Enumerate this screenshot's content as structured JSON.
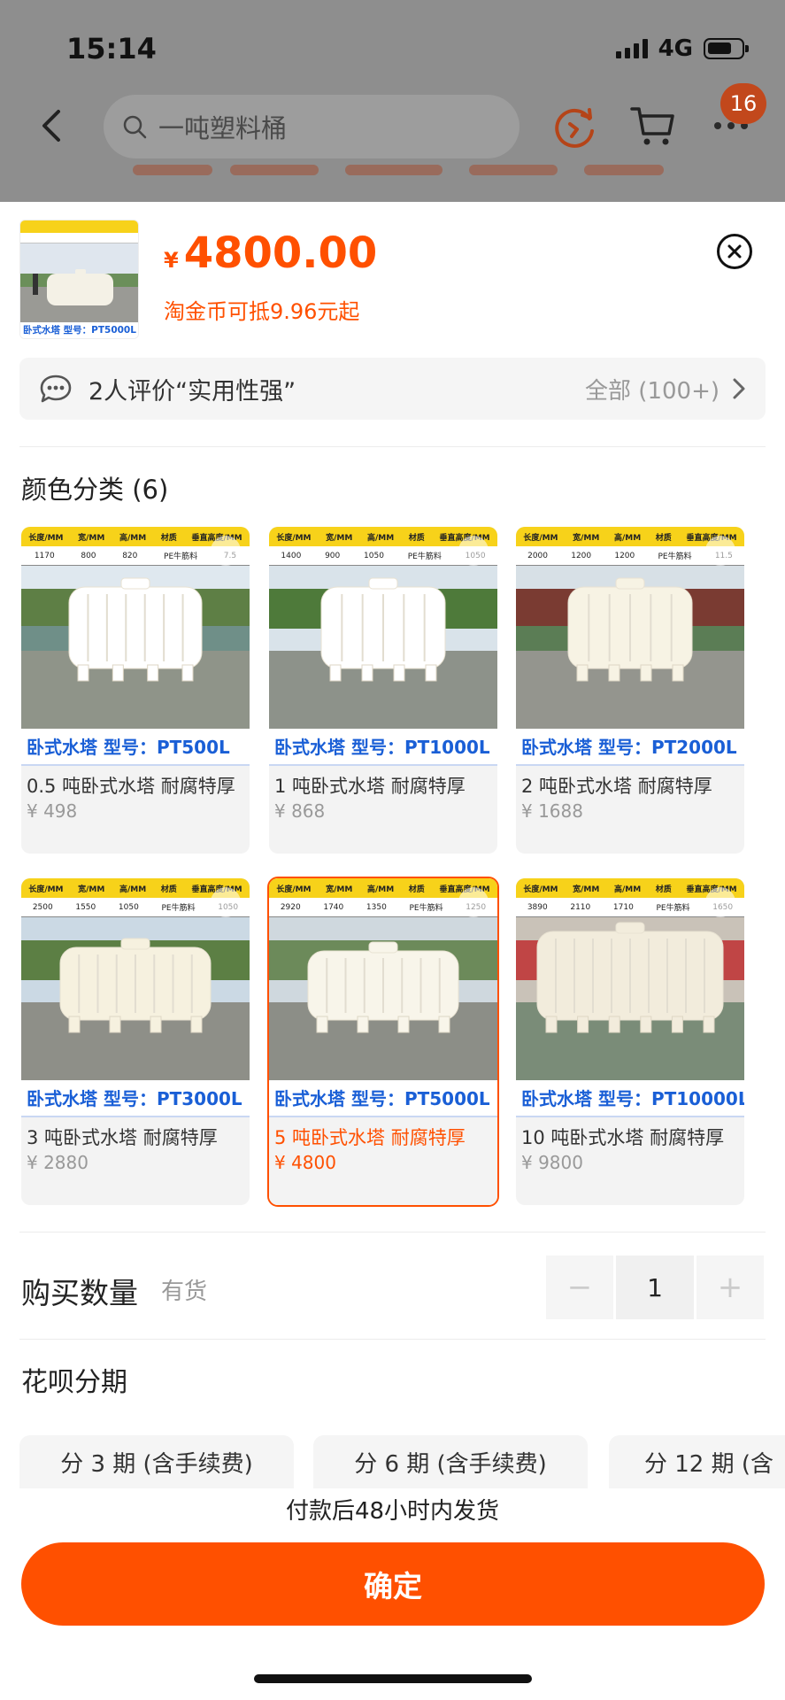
{
  "status_bar": {
    "time": "15:14",
    "network": "4G"
  },
  "background_page": {
    "search_placeholder": "一吨塑料桶",
    "cart_badge": "16"
  },
  "sheet": {
    "price_currency": "¥",
    "price": "4800.00",
    "coin_text": "淘金币可抵9.96元起",
    "thumb_label": "卧式水塔 型号：PT5000L",
    "review_text": "2人评价“实用性强”",
    "review_all": "全部 (100+)",
    "color_section_title": "颜色分类 (6)",
    "spec_headers": [
      "长度/MM",
      "宽/MM",
      "高/MM",
      "材质",
      "垂直高度/MM"
    ],
    "products": [
      {
        "model": "卧式水塔 型号：PT500L",
        "name": "0.5 吨卧式水塔 耐腐特厚",
        "price": "¥ 498",
        "specs": [
          "1170",
          "800",
          "820",
          "PE牛筋料",
          "7.5"
        ]
      },
      {
        "model": "卧式水塔 型号：PT1000L",
        "name": "1 吨卧式水塔 耐腐特厚",
        "price": "¥ 868",
        "specs": [
          "1400",
          "900",
          "1050",
          "PE牛筋料",
          "1050"
        ]
      },
      {
        "model": "卧式水塔 型号：PT2000L",
        "name": "2 吨卧式水塔 耐腐特厚",
        "price": "¥ 1688",
        "specs": [
          "2000",
          "1200",
          "1200",
          "PE牛筋料",
          "11.5"
        ]
      },
      {
        "model": "卧式水塔 型号：PT3000L",
        "name": "3 吨卧式水塔 耐腐特厚",
        "price": "¥ 2880",
        "specs": [
          "2500",
          "1550",
          "1050",
          "PE牛筋料",
          "1050"
        ]
      },
      {
        "model": "卧式水塔 型号：PT5000L",
        "name": "5 吨卧式水塔 耐腐特厚",
        "price": "¥ 4800",
        "specs": [
          "2920",
          "1740",
          "1350",
          "PE牛筋料",
          "1250"
        ]
      },
      {
        "model": "卧式水塔 型号：PT10000L",
        "name": "10 吨卧式水塔 耐腐特厚",
        "price": "¥ 9800",
        "specs": [
          "3890",
          "2110",
          "1710",
          "PE牛筋料",
          "1650"
        ]
      }
    ],
    "selected_product_index": 4,
    "quantity_label": "购买数量",
    "stock_label": "有货",
    "quantity_value": "1",
    "minus_label": "−",
    "plus_label": "+",
    "huabei_title": "花呗分期",
    "installments": [
      "分 3 期 (含手续费)",
      "分 6 期 (含手续费)",
      "分 12 期 (含"
    ],
    "shipping_note": "付款后48小时内发货",
    "confirm_label": "确定",
    "accent_color": "#ff5000",
    "model_label_color": "#1a5fd6"
  }
}
